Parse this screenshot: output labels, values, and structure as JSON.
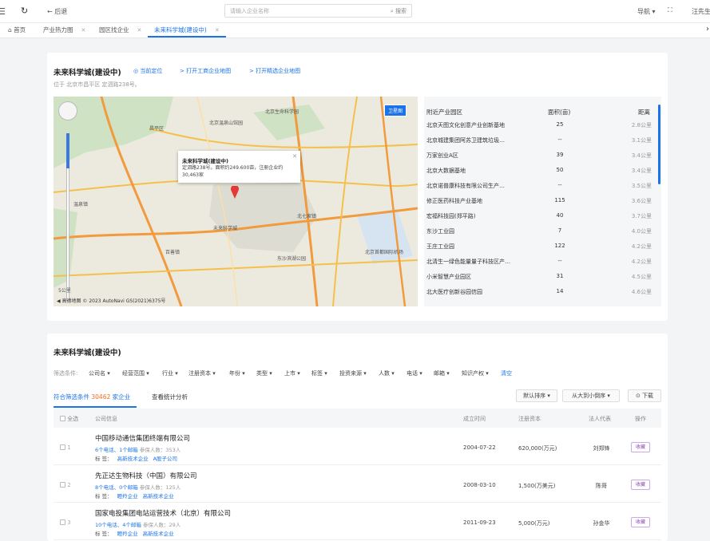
{
  "topbar": {
    "menu_icon": "menu-icon",
    "refresh_icon": "refresh-icon",
    "back_label": "← 后退",
    "search_placeholder": "请输入企业名称",
    "search_button": "⌕ 搜索",
    "nav_label": "导航 ▾",
    "fullscreen_icon": "⛶",
    "user_name": "汪先生"
  },
  "tabs": [
    {
      "label": "⌂ 首页",
      "closable": false
    },
    {
      "label": "产业热力图",
      "closable": true
    },
    {
      "label": "园区找企业",
      "closable": true
    },
    {
      "label": "未来科学城(建设中)",
      "closable": true,
      "active": true
    }
  ],
  "park": {
    "title": "未来科学城(建设中)",
    "locate": "◎ 当前定位",
    "link_gs": "> 打开工商企业地图",
    "link_jx": "> 打开精选企业地图",
    "address": "位于 北京市昌平区 定泗路238号。"
  },
  "map": {
    "sat_label": "卫星图",
    "popup_title": "未来科学城(建设中)",
    "popup_desc": "定泗路238号。面积约249.600亩，注册企业约30,463家",
    "copyright": "◀ 高德地图  © 2023 AutoNavi  GS(2021)6375号",
    "scale": "5公里",
    "labels": {
      "l1": "北京生命科学园",
      "l2": "北京森林公园",
      "l3": "北京温泉山馆园",
      "l4": "昌平区",
      "l5": "未来科学城",
      "l6": "东沙滨湖公园",
      "l7": "北京首都国际机场",
      "l8": "北七家镇",
      "l9": "回龙观",
      "l10": "温泉镇",
      "l11": "百善镇"
    }
  },
  "nearby": {
    "headers": {
      "name": "附近产业园区",
      "area": "面积(亩)",
      "dist": "距离"
    },
    "rows": [
      {
        "name": "北京天图文化创意产业创新基地",
        "area": "25",
        "dist": "2.8公里"
      },
      {
        "name": "北京城建集团阿苏卫建筑垃圾…",
        "area": "--",
        "dist": "3.1公里"
      },
      {
        "name": "万家创业A区",
        "area": "39",
        "dist": "3.4公里"
      },
      {
        "name": "北京大数据基地",
        "area": "50",
        "dist": "3.4公里"
      },
      {
        "name": "北京诺普康科技有限公司生产…",
        "area": "--",
        "dist": "3.5公里"
      },
      {
        "name": "修正医药科技产业基地",
        "area": "115",
        "dist": "3.6公里"
      },
      {
        "name": "宏福科技园(郑平路)",
        "area": "40",
        "dist": "3.7公里"
      },
      {
        "name": "东沙工业园",
        "area": "7",
        "dist": "4.0公里"
      },
      {
        "name": "王庄工业园",
        "area": "122",
        "dist": "4.2公里"
      },
      {
        "name": "北清生一绿色能量量子科技区产…",
        "area": "--",
        "dist": "4.2公里"
      },
      {
        "name": "小米智慧产业园区",
        "area": "31",
        "dist": "4.5公里"
      },
      {
        "name": "北大医疗创新谷园信园",
        "area": "14",
        "dist": "4.6公里"
      }
    ]
  },
  "section": {
    "title": "未来科学城(建设中)",
    "filter_label": "筛选条件:",
    "filters": [
      "公司名 ▾",
      "经营范围 ▾",
      "行业 ▾",
      "注册资本 ▾",
      "年份 ▾",
      "类型 ▾",
      "上市 ▾",
      "标签 ▾",
      "投资来源 ▾",
      "人数 ▾",
      "电话 ▾",
      "邮箱 ▾",
      "知识产权 ▾",
      "清空"
    ],
    "match_prefix": "符合筛选条件",
    "match_count": "30462",
    "match_suffix": "家企业",
    "stat_tab": "查看统计分析",
    "sort_btn": "默认排序 ▾",
    "order_btn": "从大到小倒序 ▾",
    "download_btn": "⊙ 下载"
  },
  "table": {
    "headers": {
      "select_all": "全选",
      "company": "公司信息",
      "date": "成立时间",
      "capital": "注册资本",
      "rep": "法人代表",
      "op": "操作"
    },
    "rows": [
      {
        "no": "1",
        "name": "中国移动通信集团终端有限公司",
        "contact": "6个电话、1个邮箱",
        "staff": "参保人数：353人",
        "tag_label": "标 签：",
        "tags": [
          "高新技术企业",
          "A股子公司"
        ],
        "date": "2004-07-22",
        "capital": "620,000(万元)",
        "rep": "刘郑锋",
        "fav": "收藏"
      },
      {
        "no": "2",
        "name": "先正达生物科技（中国）有限公司",
        "contact": "8个电话、0个邮箱",
        "staff": "参保人数：125人",
        "tag_label": "标 签：",
        "tags": [
          "瞪羚企业",
          "高新技术企业"
        ],
        "date": "2008-03-10",
        "capital": "1,500(万美元)",
        "rep": "陈哥",
        "fav": "收藏"
      },
      {
        "no": "3",
        "name": "国家电投集团电站运营技术（北京）有限公司",
        "contact": "10个电话、4个邮箱",
        "staff": "参保人数：29人",
        "tag_label": "标 签：",
        "tags": [
          "瞪羚企业",
          "高新技术企业"
        ],
        "date": "2011-09-23",
        "capital": "5,000(万元)",
        "rep": "孙金华",
        "fav": "收藏"
      }
    ]
  }
}
